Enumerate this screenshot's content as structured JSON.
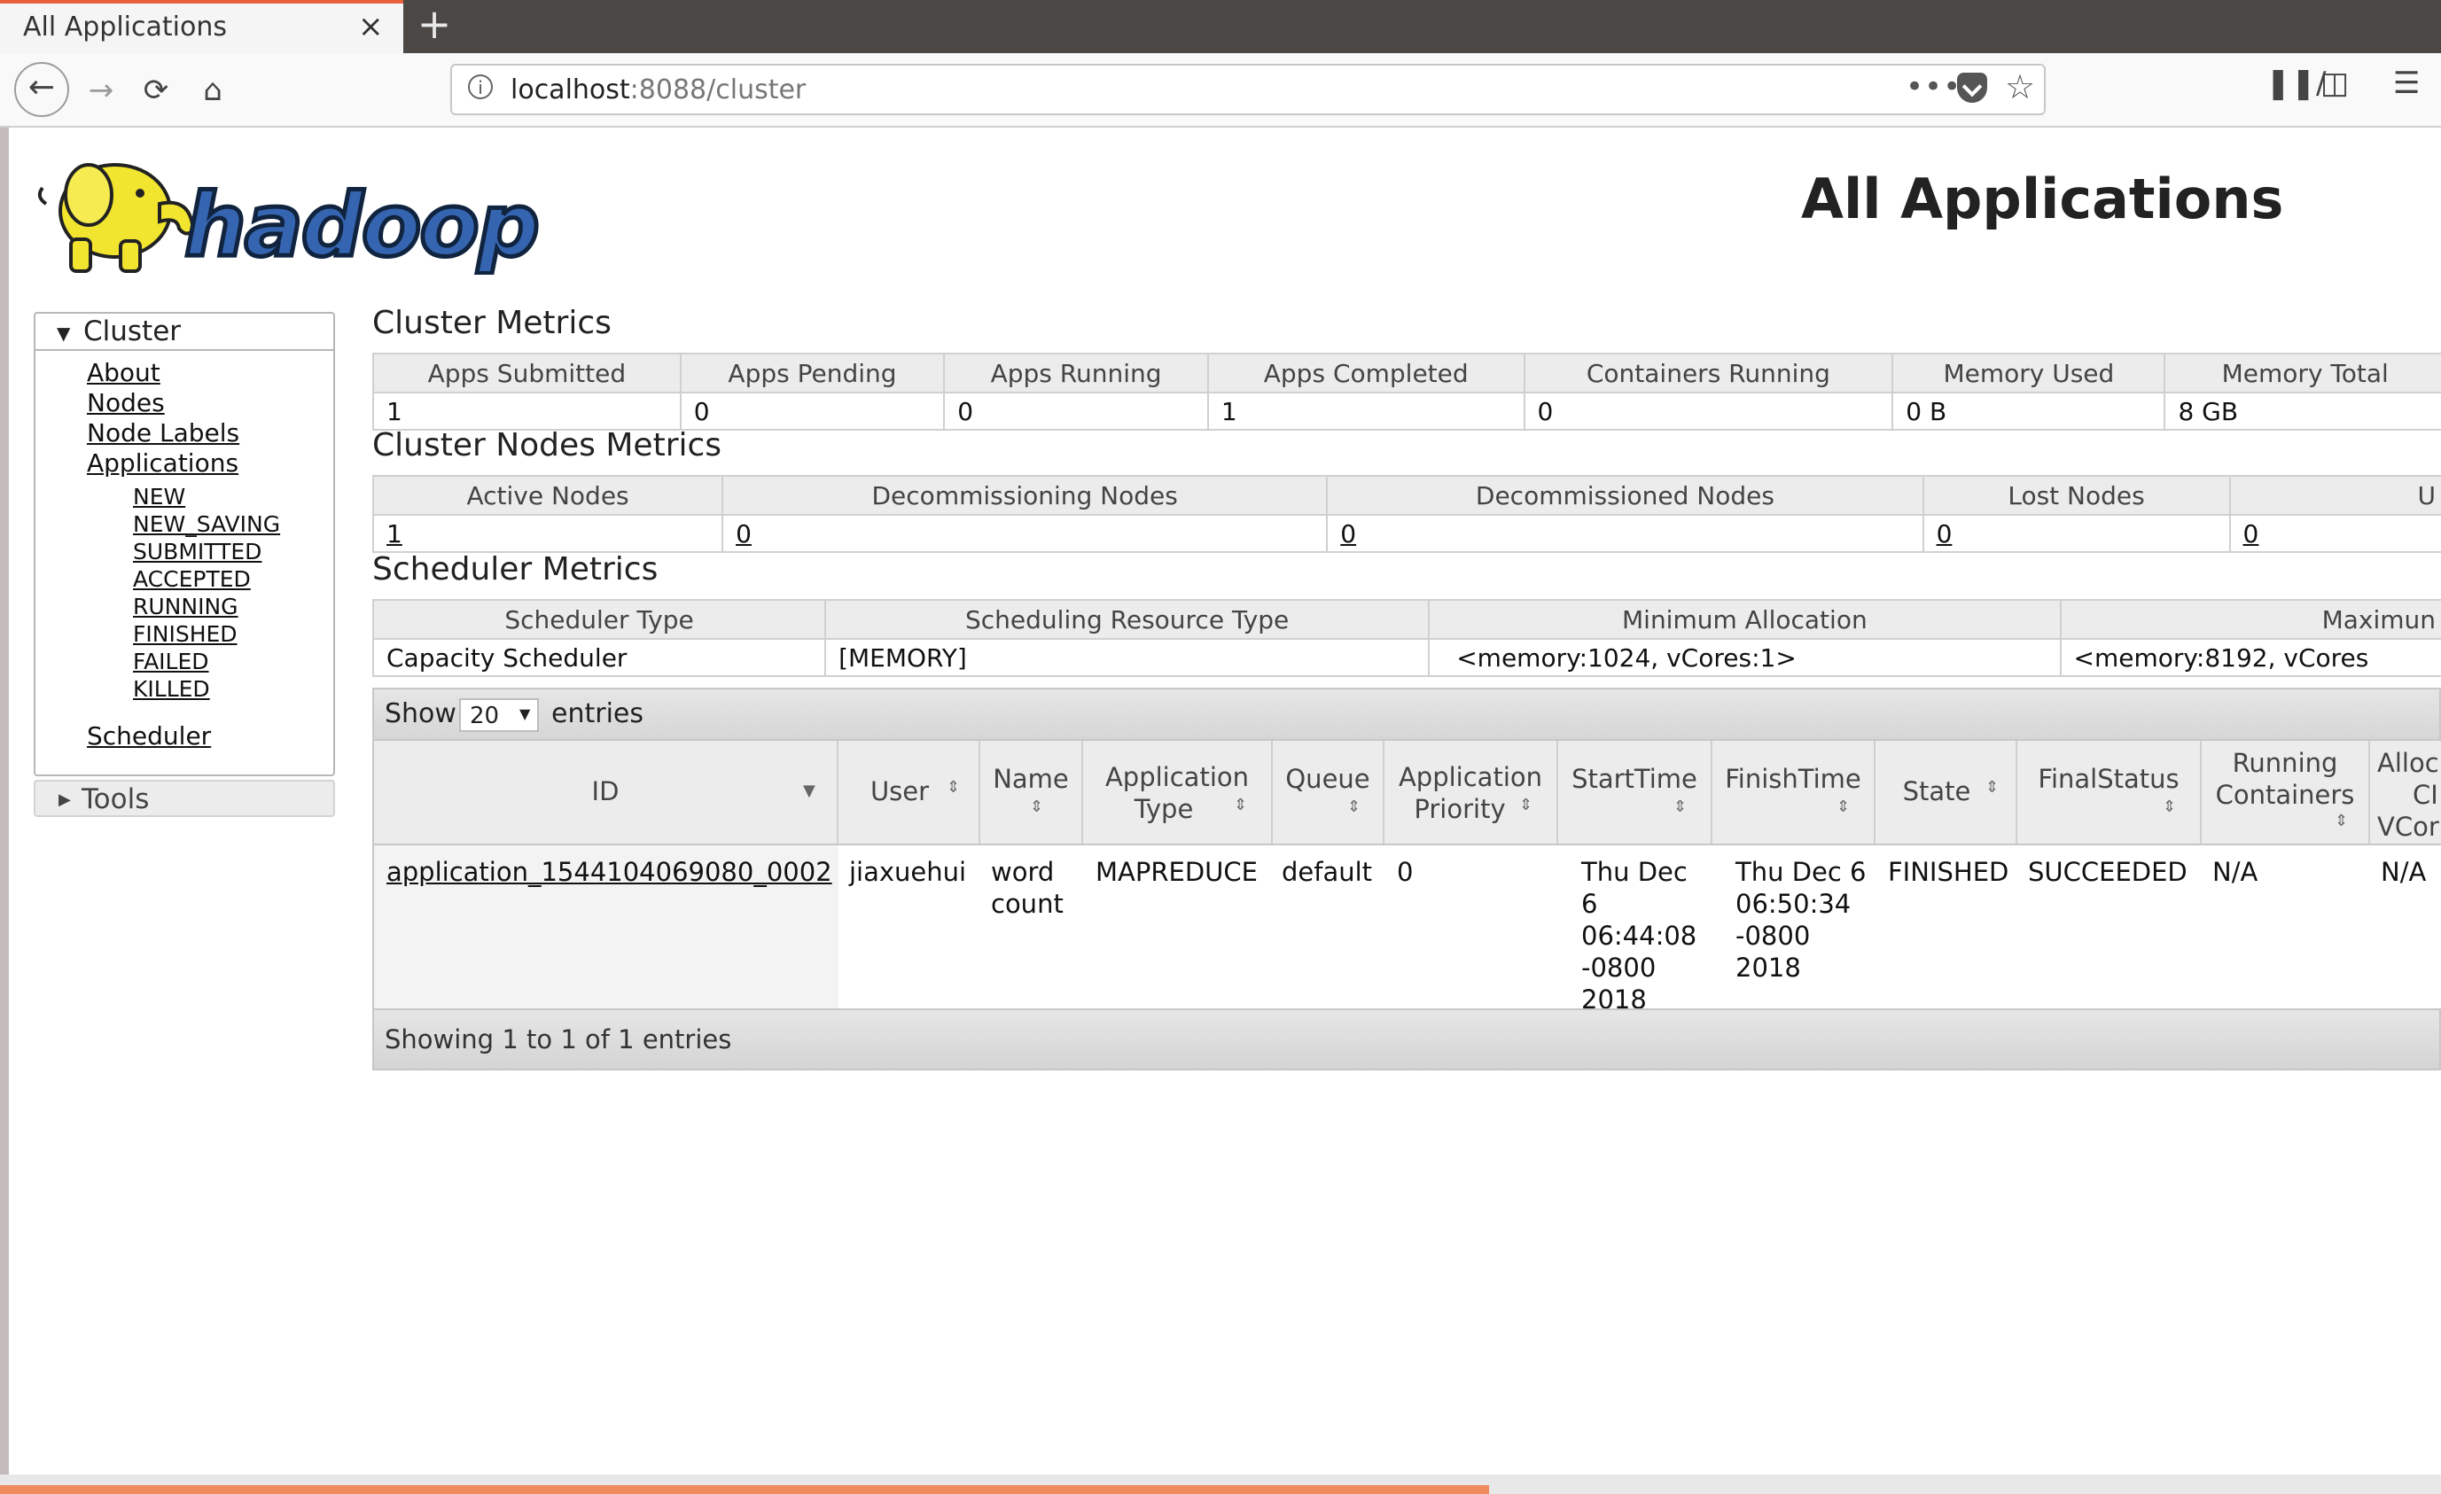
{
  "browser": {
    "tab_title": "All Applications",
    "tab_close": "×",
    "new_tab": "+",
    "url_host": "localhost",
    "url_rest": ":8088/cluster",
    "url_more": "•••",
    "load_progress": 0.61
  },
  "icons": {
    "back": "back-arrow-icon",
    "forward": "forward-arrow-icon",
    "reload": "reload-icon",
    "home": "home-icon",
    "info": "info-icon",
    "pocket": "pocket-icon",
    "bookmark": "star-icon",
    "library": "library-icon",
    "sidebar": "sidebar-icon",
    "menu": "hamburger-menu-icon",
    "logo": "hadoop-elephant-logo"
  },
  "logo_text": "hadoop",
  "page_title": "All Applications",
  "sidebar": {
    "cluster_label": "Cluster",
    "links": [
      "About",
      "Nodes",
      "Node Labels",
      "Applications"
    ],
    "states": [
      "NEW",
      "NEW_SAVING",
      "SUBMITTED",
      "ACCEPTED",
      "RUNNING",
      "FINISHED",
      "FAILED",
      "KILLED"
    ],
    "scheduler": "Scheduler",
    "tools_label": "Tools"
  },
  "cluster_metrics": {
    "title": "Cluster Metrics",
    "headers": [
      "Apps Submitted",
      "Apps Pending",
      "Apps Running",
      "Apps Completed",
      "Containers Running",
      "Memory Used",
      "Memory Total"
    ],
    "values": [
      "1",
      "0",
      "0",
      "1",
      "0",
      "0 B",
      "8 GB"
    ]
  },
  "nodes_metrics": {
    "title": "Cluster Nodes Metrics",
    "headers": [
      "Active Nodes",
      "Decommissioning Nodes",
      "Decommissioned Nodes",
      "Lost Nodes",
      "U"
    ],
    "values": [
      "1",
      "0",
      "0",
      "0",
      "0"
    ]
  },
  "scheduler_metrics": {
    "title": "Scheduler Metrics",
    "headers": [
      "Scheduler Type",
      "Scheduling Resource Type",
      "Minimum Allocation",
      "Maximun"
    ],
    "values": [
      "Capacity Scheduler",
      "[MEMORY]",
      "<memory:1024, vCores:1>",
      "<memory:8192, vCores"
    ]
  },
  "apps_table": {
    "show_label": "Show",
    "entries_value": "20",
    "entries_label": "entries",
    "headers": {
      "id": "ID",
      "user": "User",
      "name": "Name",
      "app_type_1": "Application",
      "app_type_2": "Type",
      "queue": "Queue",
      "priority_1": "Application",
      "priority_2": "Priority",
      "start": "StartTime",
      "finish": "FinishTime",
      "state": "State",
      "final": "FinalStatus",
      "running_1": "Running",
      "running_2": "Containers",
      "alloc_1": "Alloc",
      "alloc_2": "CI",
      "alloc_3": "VCor"
    },
    "row": {
      "id": "application_1544104069080_0002",
      "user": "jiaxuehui",
      "name_1": "word",
      "name_2": "count",
      "type": "MAPREDUCE",
      "queue": "default",
      "priority": "0",
      "start_1": "Thu Dec",
      "start_2": "6",
      "start_3": "06:44:08",
      "start_4": "-0800",
      "start_5": "2018",
      "finish_1": "Thu Dec 6",
      "finish_2": "06:50:34",
      "finish_3": "-0800",
      "finish_4": "2018",
      "state": "FINISHED",
      "final": "SUCCEEDED",
      "running": "N/A",
      "alloc": "N/A"
    },
    "footer": "Showing 1 to 1 of 1 entries"
  }
}
